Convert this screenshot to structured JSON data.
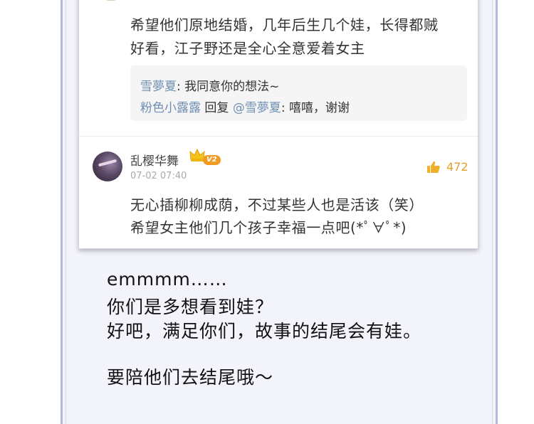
{
  "comment1": {
    "line1": "希望他们原地结婚，几年后生几个娃，长得都贼",
    "line2": "好看，江子野还是全心全意爱着女主",
    "replies": [
      {
        "author": "雪夢夏",
        "sep": ": ",
        "text": "我同意你的想法~"
      },
      {
        "author": "粉色小露露",
        "action": " 回复 ",
        "mention": "@雪夢夏",
        "sep": ": ",
        "text": "嘻嘻，谢谢"
      }
    ]
  },
  "comment2": {
    "username": "乱樱华舞",
    "badge": "V2",
    "timestamp": "07-02 07:40",
    "likes": "472",
    "line1": "无心插柳柳成荫，不过某些人也是活该（笑）",
    "line2": "希望女主他们几个孩子幸福一点吧(*ﾟ∀ﾟ*)"
  },
  "handwritten": {
    "line1": "emmmm……",
    "line2": "你们是多想看到娃？",
    "line3": "好吧，满足你们，故事的结尾会有娃。",
    "line4": "要陪他们去结尾哦～"
  },
  "colors": {
    "frame_border": "#b7b8dd",
    "link": "#6f8fb3",
    "like": "#e3a12c",
    "badge": "#f39a24"
  }
}
